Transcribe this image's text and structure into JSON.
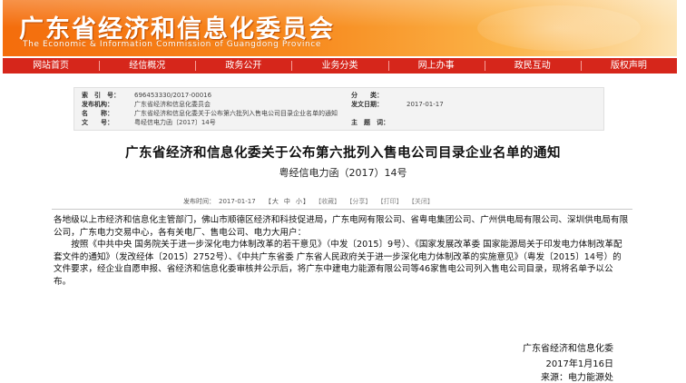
{
  "header": {
    "title": "广东省经济和信息化委员会",
    "subtitle": "The Economic & Information Commission of Guangdong Province"
  },
  "nav": {
    "items": [
      {
        "label": "网站首页"
      },
      {
        "label": "经信概况"
      },
      {
        "label": "政务公开"
      },
      {
        "label": "业务分类"
      },
      {
        "label": "网上办事"
      },
      {
        "label": "政民互动"
      },
      {
        "label": "版权声明"
      }
    ]
  },
  "meta": {
    "index_label": "索　引　号：",
    "index_value": "696453330/2017-00016",
    "category_label": "分　　类：",
    "category_value": "",
    "issuer_label": "发布机构：",
    "issuer_value": "广东省经济和信息化委员会",
    "date_label": "发文日期：",
    "date_value": "2017-01-17",
    "name_label": "名　　称：",
    "name_value": "广东省经济和信息化委关于公布第六批列入售电公司目录企业名单的通知",
    "docno_label": "文　　号：",
    "docno_value": "粤经信电力函〔2017〕14号",
    "keywords_label": "主　题　词：",
    "keywords_value": ""
  },
  "article": {
    "title": "广东省经济和信息化委关于公布第六批列入售电公司目录企业名单的通知",
    "doc_number": "粤经信电力函（2017）14号",
    "publish_time_label": "发布时间：",
    "publish_time": "2017-01-17",
    "font_size": {
      "open": "【",
      "large": "大",
      "medium": "中",
      "small": "小",
      "close": "】"
    },
    "actions": {
      "favorite": "【收藏】",
      "share": "【分享】",
      "print": "【打印】",
      "close": "【关闭】"
    },
    "para1": "各地级以上市经济和信息化主管部门，佛山市顺德区经济和科技促进局，广东电网有限公司、省粤电集团公司、广州供电局有限公司、深圳供电局有限公司，广东电力交易中心，各有关电厂、售电公司、电力大用户：",
    "para2": "按照《中共中央 国务院关于进一步深化电力体制改革的若干意见》（中发〔2015〕9号）、《国家发展改革委 国家能源局关于印发电力体制改革配套文件的通知》（发改经体〔2015〕2752号）、《中共广东省委 广东省人民政府关于进一步深化电力体制改革的实施意见》（粤发〔2015〕14号）的文件要求，经企业自愿申报、省经济和信息化委审核并公示后，将广东中建电力能源有限公司等46家售电公司列入售电公司目录，现将名单予以公布。",
    "signer": "广东省经济和信息化委",
    "sign_date": "2017年1月16日",
    "source": "来源：电力能源处"
  },
  "colors": {
    "banner": "#f46d0c",
    "nav": "#d6261b",
    "meta_bg": "#f3f3f3"
  }
}
